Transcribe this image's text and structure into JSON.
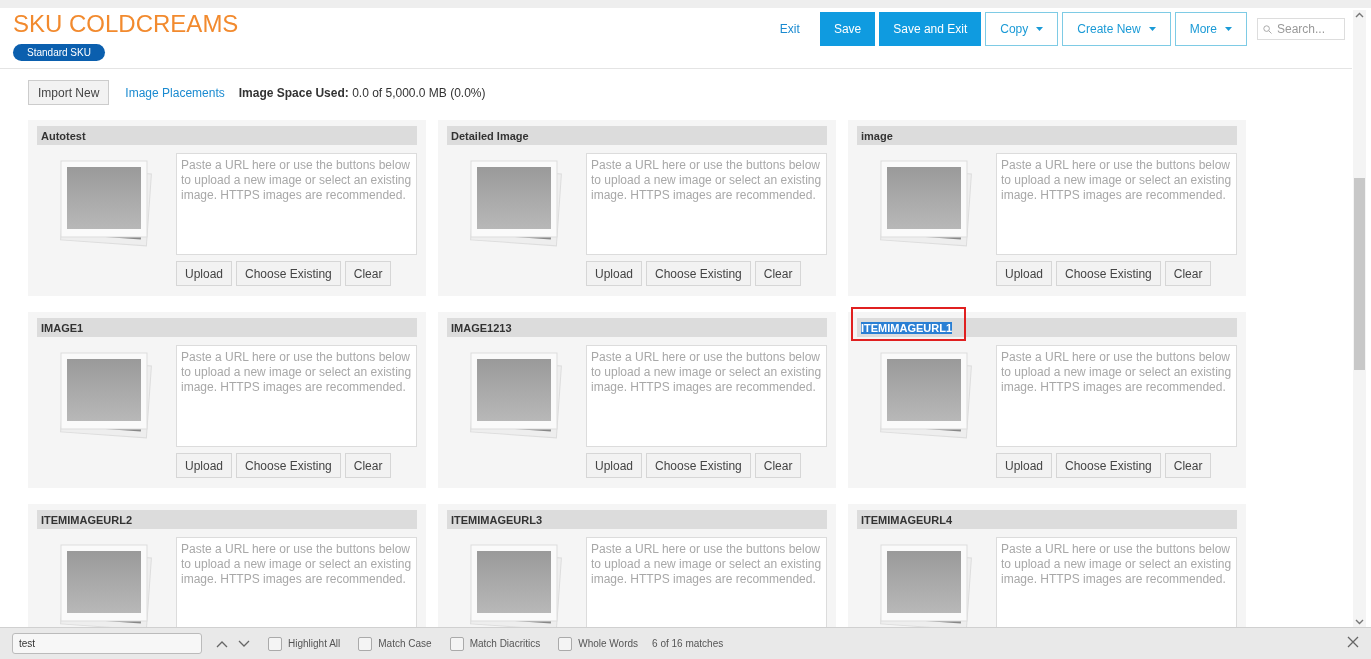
{
  "header": {
    "title": "SKU COLDCREAMS",
    "badge": "Standard SKU",
    "exit_link": "Exit",
    "buttons": [
      {
        "label": "Save",
        "kind": "primary"
      },
      {
        "label": "Save and Exit",
        "kind": "primary"
      },
      {
        "label": "Copy",
        "kind": "dropdown"
      },
      {
        "label": "Create New",
        "kind": "dropdown"
      },
      {
        "label": "More",
        "kind": "dropdown"
      }
    ],
    "search": {
      "placeholder": "Search..."
    }
  },
  "toolbar": {
    "import_button": "Import New",
    "placements_link": "Image Placements",
    "space_label": "Image Space Used:",
    "space_value": "0.0 of 5,000.0 MB (0.0%)"
  },
  "cards": [
    {
      "title": "Autotest",
      "highlighted": false,
      "url_field": {
        "placeholder": "Paste a URL here or use the buttons below to upload a new image or select an existing image. HTTPS images are recommended."
      },
      "buttons": [
        "Upload",
        "Choose Existing",
        "Clear"
      ]
    },
    {
      "title": "Detailed Image",
      "highlighted": false,
      "url_field": {
        "placeholder": "Paste a URL here or use the buttons below to upload a new image or select an existing image. HTTPS images are recommended."
      },
      "buttons": [
        "Upload",
        "Choose Existing",
        "Clear"
      ]
    },
    {
      "title": "image",
      "highlighted": false,
      "url_field": {
        "placeholder": "Paste a URL here or use the buttons below to upload a new image or select an existing image. HTTPS images are recommended."
      },
      "buttons": [
        "Upload",
        "Choose Existing",
        "Clear"
      ]
    },
    {
      "title": "IMAGE1",
      "highlighted": false,
      "url_field": {
        "placeholder": "Paste a URL here or use the buttons below to upload a new image or select an existing image. HTTPS images are recommended."
      },
      "buttons": [
        "Upload",
        "Choose Existing",
        "Clear"
      ]
    },
    {
      "title": "IMAGE1213",
      "highlighted": false,
      "url_field": {
        "placeholder": "Paste a URL here or use the buttons below to upload a new image or select an existing image. HTTPS images are recommended."
      },
      "buttons": [
        "Upload",
        "Choose Existing",
        "Clear"
      ]
    },
    {
      "title": "ITEMIMAGEURL1",
      "highlighted": true,
      "url_field": {
        "placeholder": "Paste a URL here or use the buttons below to upload a new image or select an existing image. HTTPS images are recommended."
      },
      "buttons": [
        "Upload",
        "Choose Existing",
        "Clear"
      ]
    },
    {
      "title": "ITEMIMAGEURL2",
      "highlighted": false,
      "url_field": {
        "placeholder": "Paste a URL here or use the buttons below to upload a new image or select an existing image. HTTPS images are recommended."
      }
    },
    {
      "title": "ITEMIMAGEURL3",
      "highlighted": false,
      "url_field": {
        "placeholder": "Paste a URL here or use the buttons below to upload a new image or select an existing image. HTTPS images are recommended."
      }
    },
    {
      "title": "ITEMIMAGEURL4",
      "highlighted": false,
      "url_field": {
        "placeholder": "Paste a URL here or use the buttons below to upload a new image or select an existing image. HTTPS images are recommended."
      }
    }
  ],
  "find_bar": {
    "field": {
      "value": "test"
    },
    "options": [
      {
        "label": "Highlight All",
        "checked": false
      },
      {
        "label": "Match Case",
        "checked": false
      },
      {
        "label": "Match Diacritics",
        "checked": false
      },
      {
        "label": "Whole Words",
        "checked": false
      }
    ],
    "status": "6 of 16 matches"
  }
}
